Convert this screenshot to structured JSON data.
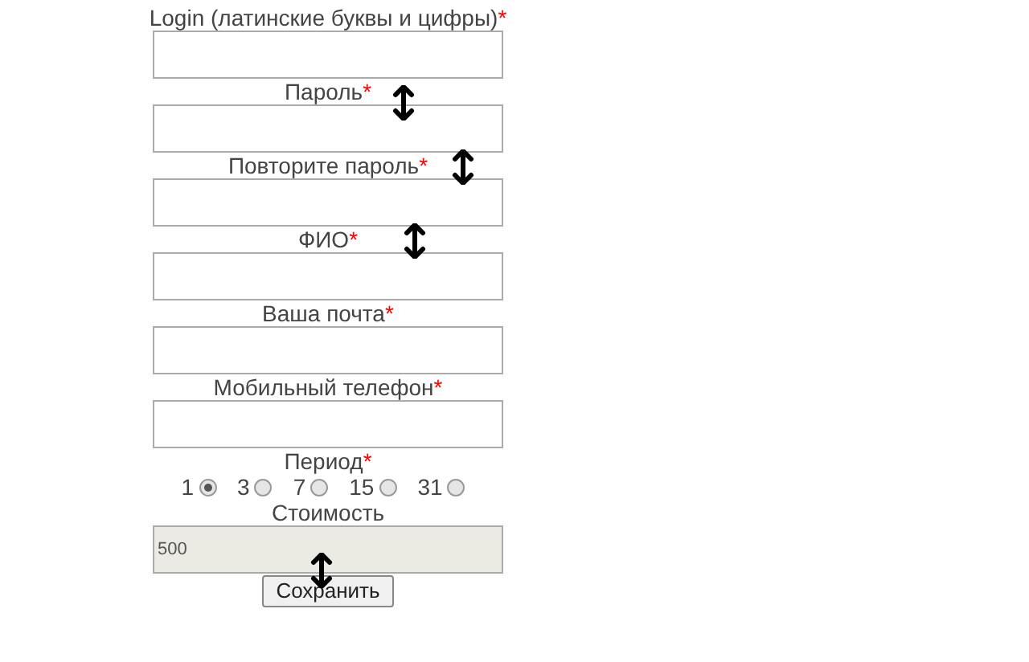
{
  "fields": [
    {
      "kind": "text",
      "label": "Login (латинские буквы и цифры)",
      "mark": "*"
    },
    {
      "kind": "text",
      "label": "Пароль",
      "mark": "*"
    },
    {
      "kind": "text",
      "label": "Повторите пароль",
      "mark": "*"
    },
    {
      "kind": "text",
      "label": "ФИО",
      "mark": "*"
    },
    {
      "kind": "text",
      "label": "Ваша почта",
      "mark": "*"
    },
    {
      "kind": "text",
      "label": "Мобильный телефон",
      "mark": "*"
    },
    {
      "kind": "radio",
      "label": "Период",
      "mark": "*",
      "options": [
        {
          "label": "1",
          "selected": true
        },
        {
          "label": "3",
          "selected": false
        },
        {
          "label": "7",
          "selected": false
        },
        {
          "label": "15",
          "selected": false
        },
        {
          "label": "31",
          "selected": false
        }
      ]
    },
    {
      "kind": "readonly",
      "label": "Стоимость",
      "value": "500"
    }
  ],
  "submit": "Сохранить"
}
